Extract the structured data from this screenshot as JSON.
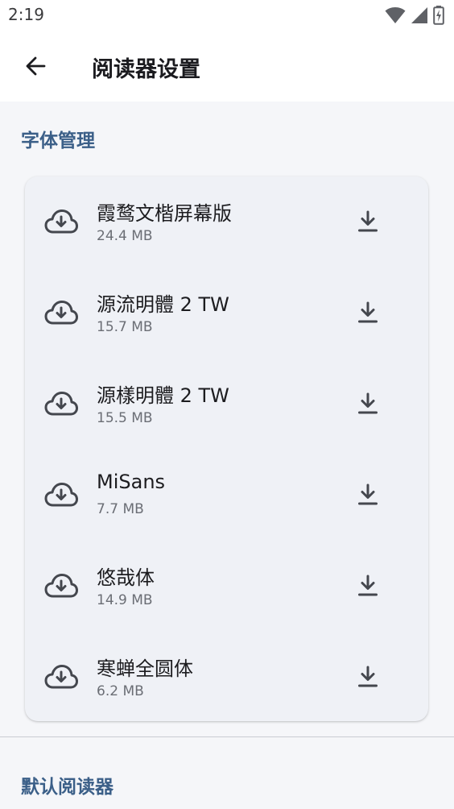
{
  "status_bar": {
    "time": "2:19",
    "icons": [
      "wifi-icon",
      "signal-icon",
      "battery-icon"
    ]
  },
  "app_bar": {
    "back_icon": "arrow-left-icon",
    "title": "阅读器设置"
  },
  "colors": {
    "accent": "#3b5f88",
    "card_background": "#eff1f6",
    "page_background": "#f5f6f9",
    "icon": "#44474e"
  },
  "font_section": {
    "title": "字体管理",
    "items": [
      {
        "name": "霞鹜文楷屏幕版",
        "size": "24.4 MB",
        "icon": "cloud-download-icon",
        "action_icon": "download-icon"
      },
      {
        "name": "源流明體 2 TW",
        "size": "15.7 MB",
        "icon": "cloud-download-icon",
        "action_icon": "download-icon"
      },
      {
        "name": "源樣明體 2 TW",
        "size": "15.5 MB",
        "icon": "cloud-download-icon",
        "action_icon": "download-icon"
      },
      {
        "name": "MiSans",
        "size": "7.7 MB",
        "icon": "cloud-download-icon",
        "action_icon": "download-icon"
      },
      {
        "name": "悠哉体",
        "size": "14.9 MB",
        "icon": "cloud-download-icon",
        "action_icon": "download-icon"
      },
      {
        "name": "寒蝉全圆体",
        "size": "6.2 MB",
        "icon": "cloud-download-icon",
        "action_icon": "download-icon"
      }
    ]
  },
  "reader_section": {
    "title": "默认阅读器"
  }
}
